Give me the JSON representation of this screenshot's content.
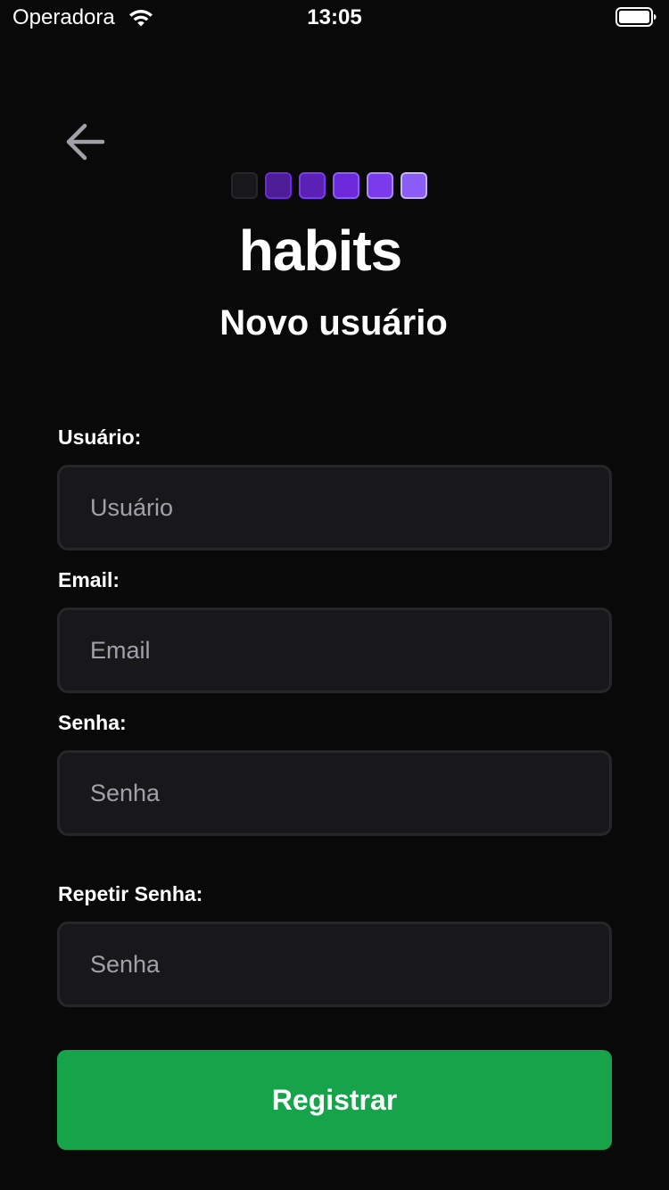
{
  "status_bar": {
    "carrier": "Operadora",
    "time": "13:05",
    "wifi_icon": "wifi-icon",
    "battery_icon": "battery-full-icon"
  },
  "header": {
    "back_icon": "arrow-left-icon",
    "logo": {
      "text": "habits",
      "squares": [
        {
          "fill": "#18181b",
          "border": "#27272a"
        },
        {
          "fill": "#4c1d95",
          "border": "#6d28d9"
        },
        {
          "fill": "#5b21b6",
          "border": "#7c3aed"
        },
        {
          "fill": "#6d28d9",
          "border": "#8b5cf6"
        },
        {
          "fill": "#7c3aed",
          "border": "#a78bfa"
        },
        {
          "fill": "#8b5cf6",
          "border": "#c4b5fd"
        }
      ]
    },
    "title": "Novo usuário"
  },
  "form": {
    "username": {
      "label": "Usuário:",
      "placeholder": "Usuário",
      "value": ""
    },
    "email": {
      "label": "Email:",
      "placeholder": "Email",
      "value": ""
    },
    "password": {
      "label": "Senha:",
      "placeholder": "Senha",
      "value": ""
    },
    "repeat_password": {
      "label": "Repetir Senha:",
      "placeholder": "Senha",
      "value": ""
    },
    "submit_label": "Registrar"
  },
  "colors": {
    "background": "#09090a",
    "input_background": "#18181b",
    "input_border": "#27272a",
    "placeholder": "#a1a1aa",
    "submit": "#16a34a"
  }
}
